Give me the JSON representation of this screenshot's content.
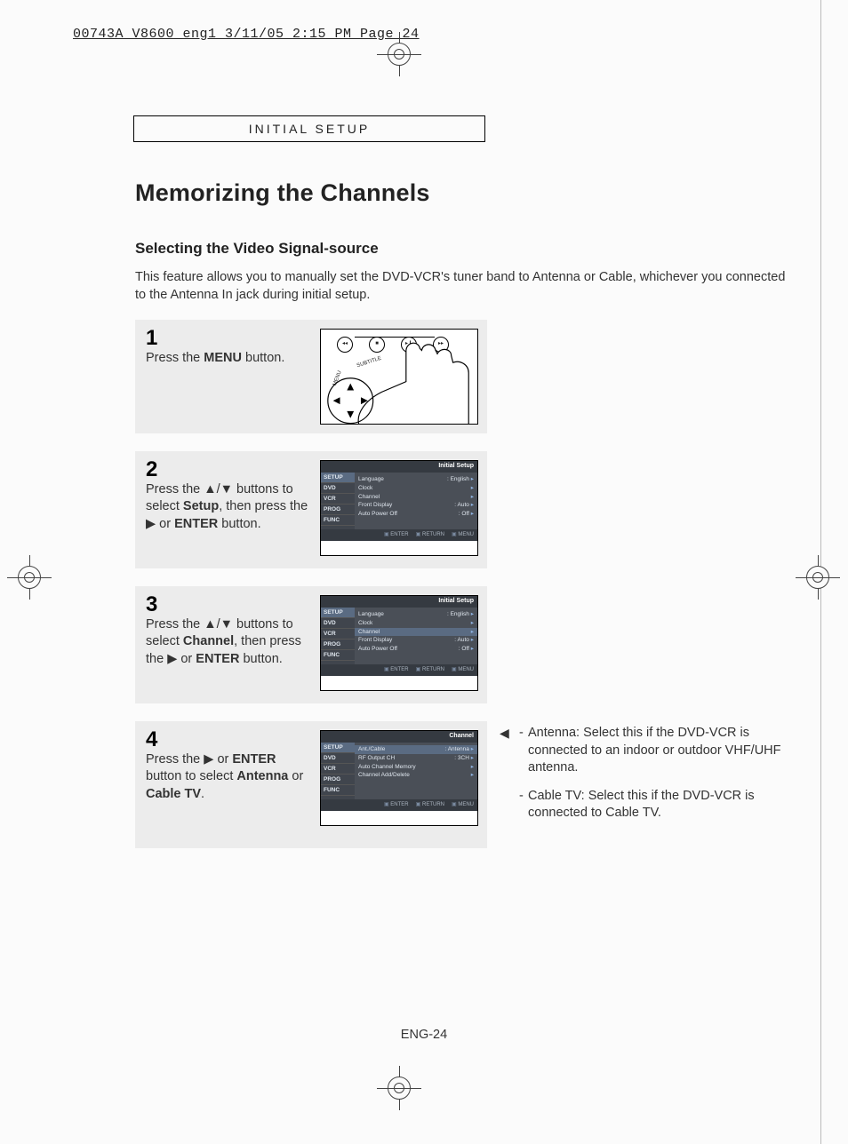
{
  "header": "00743A V8600_eng1  3/11/05  2:15 PM  Page 24",
  "section_label": "INITIAL SETUP",
  "h1": "Memorizing the Channels",
  "h2": "Selecting the Video Signal-source",
  "intro": "This feature allows you to manually set the DVD-VCR's tuner band to Antenna or Cable, whichever you connected to the Antenna In jack during initial setup.",
  "steps": {
    "s1": {
      "num": "1",
      "pre": "Press the ",
      "bold": "MENU",
      "post": " button."
    },
    "s2": {
      "num": "2",
      "pre": "Press the ▲/▼ buttons to select ",
      "bold": "Setup",
      "post1": ", then press the ",
      "tri": "▶",
      "post2": " or ",
      "bold2": "ENTER",
      "post3": " button."
    },
    "s3": {
      "num": "3",
      "pre": "Press the ▲/▼ buttons to select ",
      "bold": "Channel",
      "post1": ", then press the ",
      "tri": "▶",
      "post2": " or ",
      "bold2": "ENTER",
      "post3": " button."
    },
    "s4": {
      "num": "4",
      "pre": "Press the ",
      "tri": "▶",
      "post1": " or ",
      "bold": "ENTER",
      "post2": " button to select ",
      "bold2": "Antenna",
      "post3": " or ",
      "bold3": "Cable TV",
      "post4": "."
    }
  },
  "osd": {
    "side": [
      "SETUP",
      "DVD",
      "VCR",
      "PROG",
      "FUNC"
    ],
    "title12": "Initial Setup",
    "rows12": [
      {
        "l": "Language",
        "r": ": English"
      },
      {
        "l": "Clock",
        "r": ""
      },
      {
        "l": "Channel",
        "r": ""
      },
      {
        "l": "Front Display",
        "r": ": Auto"
      },
      {
        "l": "Auto Power Off",
        "r": ": Off"
      }
    ],
    "title4": "Channel",
    "rows4": [
      {
        "l": "Ant./Cable",
        "r": ": Antenna"
      },
      {
        "l": "RF Output CH",
        "r": ": 3CH"
      },
      {
        "l": "Auto Channel Memory",
        "r": ""
      },
      {
        "l": "Channel Add/Delete",
        "r": ""
      }
    ],
    "foot": [
      "ENTER",
      "RETURN",
      "MENU"
    ]
  },
  "side_note": {
    "icon": "◀",
    "n1": "Antenna: Select this if the DVD-VCR is connected to an indoor or outdoor VHF/UHF antenna.",
    "n2": "Cable TV: Select this if the DVD-VCR is connected to Cable TV."
  },
  "page_number": "ENG-24",
  "remote_labels": {
    "subtitle": "SUBTITLE",
    "menu": "MENU"
  }
}
